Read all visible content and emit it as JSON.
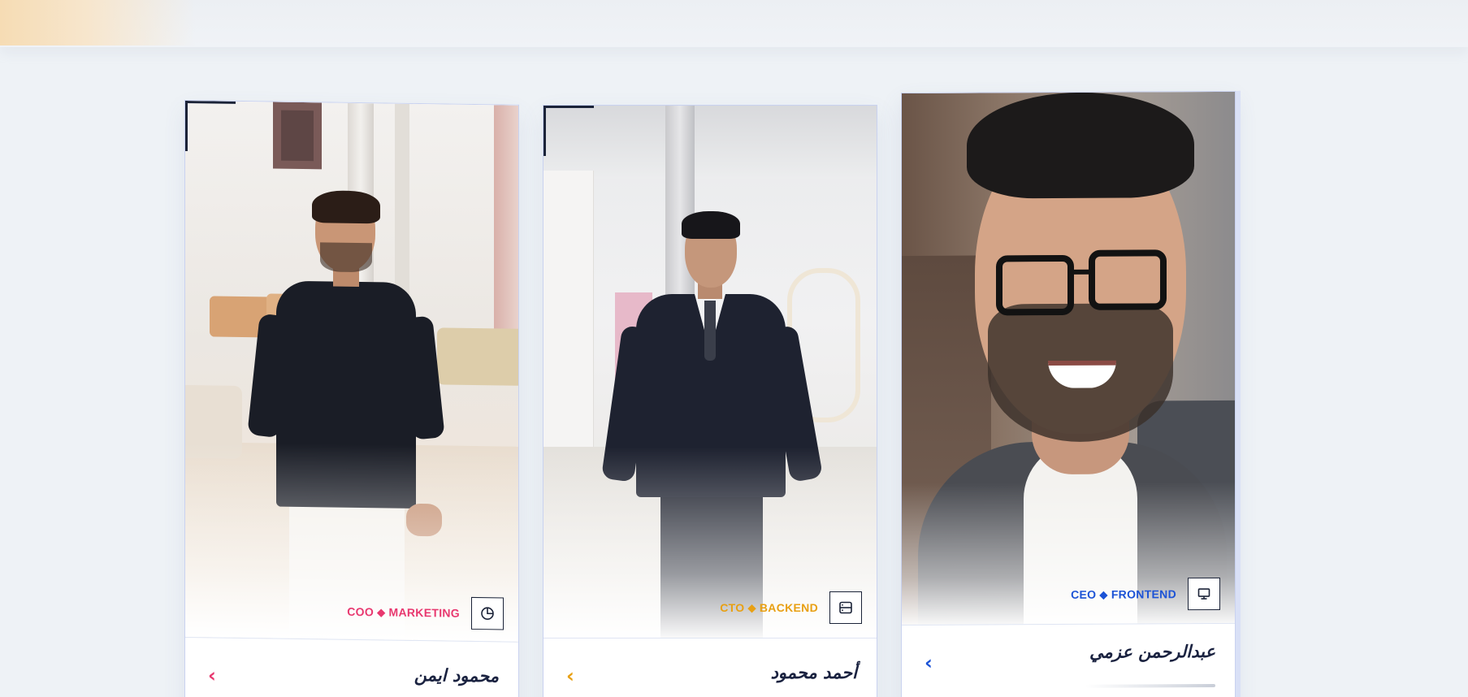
{
  "colors": {
    "background": "#eef2f6",
    "heading_dark": "#1a2240",
    "accent_marketing": "#e8386f",
    "accent_backend": "#e8a013",
    "accent_frontend": "#1c53d6"
  },
  "team": [
    {
      "name": "محمود ايمن",
      "role": "COO ⬥ MARKETING",
      "role_icon": "pie-chart-icon",
      "accent": "#e8386f",
      "arrow": "‹"
    },
    {
      "name": "أحمد محمود",
      "role": "CTO ⬥ BACKEND",
      "role_icon": "server-icon",
      "accent": "#e8a013",
      "arrow": "‹"
    },
    {
      "name": "عبدالرحمن عزمي",
      "role": "CEO ⬥ FRONTEND",
      "role_icon": "monitor-icon",
      "accent": "#1c53d6",
      "arrow": "‹"
    }
  ]
}
